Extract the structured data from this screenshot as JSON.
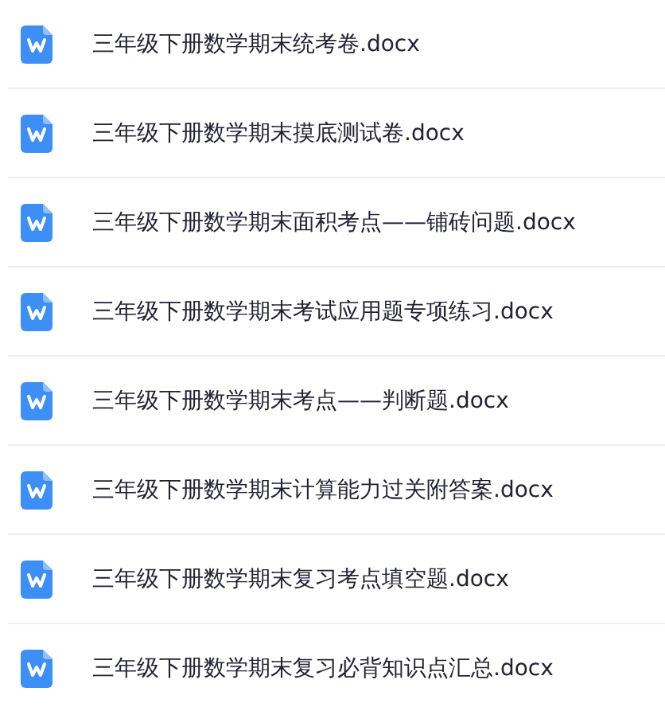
{
  "files": [
    {
      "name": "三年级下册数学期末统考卷.docx"
    },
    {
      "name": "三年级下册数学期末摸底测试卷.docx"
    },
    {
      "name": "三年级下册数学期末面积考点——铺砖问题.docx"
    },
    {
      "name": "三年级下册数学期末考试应用题专项练习.docx"
    },
    {
      "name": "三年级下册数学期末考点——判断题.docx"
    },
    {
      "name": "三年级下册数学期末计算能力过关附答案.docx"
    },
    {
      "name": "三年级下册数学期末复习考点填空题.docx"
    },
    {
      "name": "三年级下册数学期末复习必背知识点汇总.docx"
    }
  ]
}
